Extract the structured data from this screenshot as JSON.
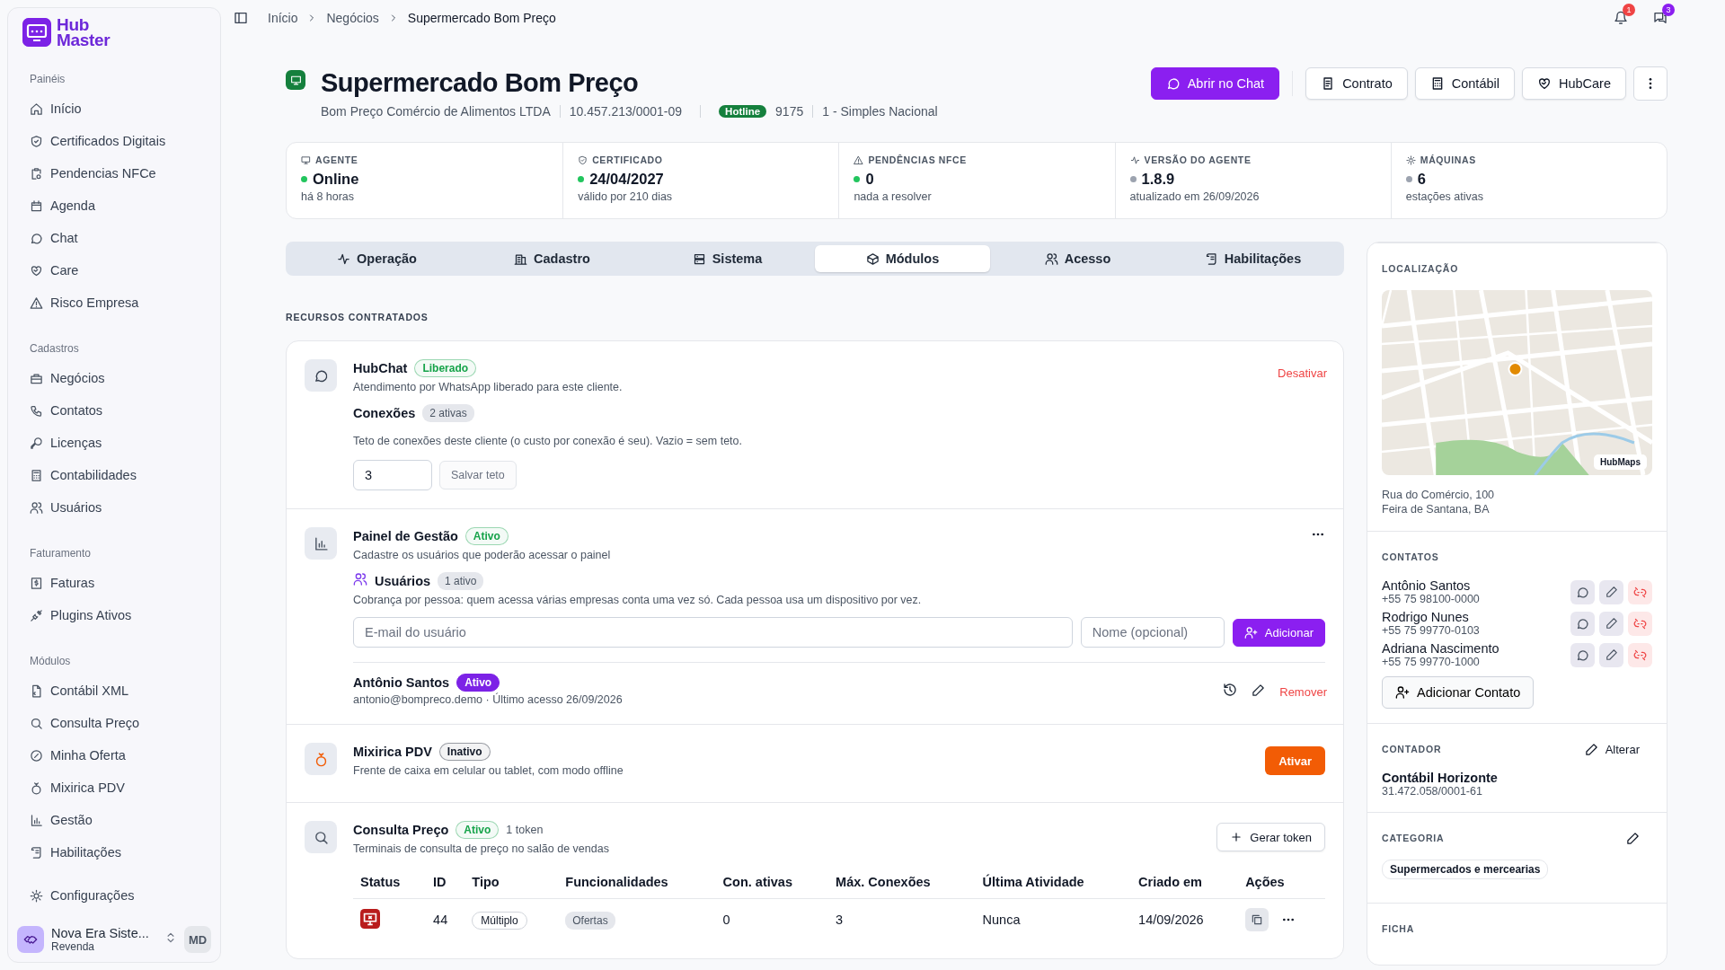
{
  "sidebar": {
    "logo": {
      "line1": "Hub",
      "line2": "Master"
    },
    "sections": [
      {
        "title": "Painéis",
        "items": [
          "Início",
          "Certificados Digitais",
          "Pendencias NFCe",
          "Agenda",
          "Chat",
          "Care",
          "Risco Empresa"
        ]
      },
      {
        "title": "Cadastros",
        "items": [
          "Negócios",
          "Contatos",
          "Licenças",
          "Contabilidades",
          "Usuários"
        ]
      },
      {
        "title": "Faturamento",
        "items": [
          "Faturas",
          "Plugins Ativos"
        ]
      },
      {
        "title": "Módulos",
        "items": [
          "Contábil XML",
          "Consulta Preço",
          "Minha Oferta",
          "Mixirica PDV",
          "Gestão",
          "Habilitações"
        ]
      },
      {
        "items": [
          "Configurações"
        ]
      }
    ],
    "account": {
      "name": "Nova Era Siste...",
      "role": "Revenda",
      "initials": "MD"
    }
  },
  "breadcrumbs": [
    "Início",
    "Negócios",
    "Supermercado Bom Preço"
  ],
  "notifications": {
    "bell_count": "1",
    "messages_count": "3"
  },
  "business": {
    "title": "Supermercado Bom Preço",
    "legal_name": "Bom Preço Comércio de Alimentos LTDA",
    "cnpj": "10.457.213/0001-09",
    "hotline_label": "Hotline",
    "hotline": "9175",
    "tax_regime": "1 - Simples Nacional"
  },
  "actions": [
    {
      "label": "Abrir no Chat",
      "kind": "primary"
    },
    {
      "label": "Contrato",
      "kind": "outline"
    },
    {
      "label": "Contábil",
      "kind": "outline"
    },
    {
      "label": "HubCare",
      "kind": "outline"
    }
  ],
  "stats": [
    {
      "label": "AGENTE",
      "value": "Online",
      "note": "há 8 horas",
      "color": "#22c55e"
    },
    {
      "label": "CERTIFICADO",
      "value": "24/04/2027",
      "note": "válido por 210 dias",
      "color": "#22c55e"
    },
    {
      "label": "PENDÊNCIAS NFCE",
      "value": "0",
      "note": "nada a resolver",
      "color": "#22c55e"
    },
    {
      "label": "VERSÃO DO AGENTE",
      "value": "1.8.9",
      "note": "atualizado em 26/09/2026",
      "color": "#9ca3af"
    },
    {
      "label": "MÁQUINAS",
      "value": "6",
      "note": "estações ativas",
      "color": "#9ca3af"
    }
  ],
  "tabs": [
    {
      "label": "Operação",
      "selected": false
    },
    {
      "label": "Cadastro",
      "selected": false
    },
    {
      "label": "Sistema",
      "selected": false
    },
    {
      "label": "Módulos",
      "selected": true
    },
    {
      "label": "Acesso",
      "selected": false
    },
    {
      "label": "Habilitações",
      "selected": false
    }
  ],
  "section_title": "RECURSOS CONTRATADOS",
  "modules": [
    {
      "kind": "chat",
      "name": "HubChat",
      "status": {
        "label": "Liberado",
        "color": "#16a34a"
      },
      "description": "Atendimento por WhatsApp liberado para este cliente.",
      "action": {
        "label": "Desativar",
        "kind": "danger-link"
      },
      "connections": {
        "label": "Conexões",
        "count": "2 ativas",
        "hint": "Teto de conexões deste cliente (o custo por conexão é seu). Vazio = sem teto.",
        "value": "3",
        "save": "Salvar teto"
      }
    },
    {
      "kind": "panel",
      "name": "Painel de Gestão",
      "status": {
        "label": "Ativo",
        "color": "#16a34a"
      },
      "description": "Cadastre os usuários que poderão acessar o painel",
      "users": {
        "label": "Usuários",
        "count": "1 ativo",
        "hint": "Cobrança por pessoa: quem acessa várias empresas conta uma vez só. Cada pessoa usa um dispositivo por vez.",
        "email_placeholder": "E-mail do usuário",
        "name_placeholder": "Nome (opcional)",
        "add": "Adicionar",
        "list": [
          {
            "name": "Antônio Santos",
            "status": "Ativo",
            "detail": "antonio@bompreco.demo · Último acesso 26/09/2026",
            "remove": "Remover"
          }
        ]
      }
    },
    {
      "kind": "pdv",
      "name": "Mixirica PDV",
      "status": {
        "label": "Inativo",
        "color": "#111827"
      },
      "description": "Frente de caixa em celular ou tablet, com modo offline",
      "action": {
        "label": "Ativar",
        "kind": "solid"
      }
    },
    {
      "kind": "price",
      "name": "Consulta Preço",
      "status": {
        "label": "Ativo",
        "color": "#16a34a"
      },
      "extra": "1 token",
      "description": "Terminais de consulta de preço no salão de vendas",
      "action": {
        "label": "Gerar token",
        "kind": "outline"
      },
      "table": {
        "columns": [
          "Status",
          "ID",
          "Tipo",
          "Funcionalidades",
          "Con. ativas",
          "Máx. Conexões",
          "Última Atividade",
          "Criado em",
          "Ações"
        ],
        "rows": [
          {
            "id": "44",
            "type": "Múltiplo",
            "feature": "Ofertas",
            "active": "0",
            "max": "3",
            "last": "Nunca",
            "created": "14/09/2026"
          }
        ]
      }
    }
  ],
  "side": {
    "location": {
      "title": "LOCALIZAÇÃO",
      "map_label": "HubMaps",
      "address": [
        "Rua do Comércio, 100",
        "Feira de Santana, BA"
      ]
    },
    "contacts": {
      "title": "CONTATOS",
      "list": [
        {
          "name": "Antônio Santos",
          "phone": "+55 75 98100-0000"
        },
        {
          "name": "Rodrigo Nunes",
          "phone": "+55 75 99770-0103"
        },
        {
          "name": "Adriana Nascimento",
          "phone": "+55 75 99770-1000"
        }
      ],
      "add": "Adicionar Contato"
    },
    "accountant": {
      "title": "CONTADOR",
      "edit": "Alterar",
      "name": "Contábil Horizonte",
      "cnpj": "31.472.058/0001-61"
    },
    "category": {
      "title": "CATEGORIA",
      "tag": "Supermercados e mercearias"
    },
    "file": {
      "title": "FICHA"
    }
  }
}
